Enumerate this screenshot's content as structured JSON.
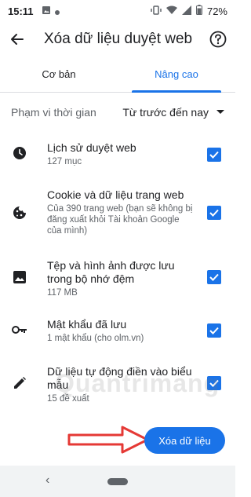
{
  "status": {
    "time": "15:11",
    "battery": "72%"
  },
  "appbar": {
    "title": "Xóa dữ liệu duyệt web"
  },
  "tabs": [
    {
      "label": "Cơ bản"
    },
    {
      "label": "Nâng cao"
    }
  ],
  "range": {
    "label": "Phạm vi thời gian",
    "value": "Từ trước đến nay"
  },
  "items": [
    {
      "title": "Lịch sử duyệt web",
      "subtitle": "127 mục",
      "icon": "clock-icon"
    },
    {
      "title": "Cookie và dữ liệu trang web",
      "subtitle": "Của 390 trang web (bạn sẽ không bị đăng xuất khỏi Tài khoản Google của mình)",
      "icon": "cookie-icon"
    },
    {
      "title": "Tệp và hình ảnh được lưu trong bộ nhớ đệm",
      "subtitle": "117 MB",
      "icon": "image-icon"
    },
    {
      "title": "Mật khẩu đã lưu",
      "subtitle": "1 mật khẩu (cho olm.vn)",
      "icon": "key-icon"
    },
    {
      "title": "Dữ liệu tự động điền vào biểu mẫu",
      "subtitle": "15 đề xuất",
      "icon": "pencil-icon"
    }
  ],
  "watermark": "Quantrimang",
  "action": {
    "label": "Xóa dữ liệu"
  },
  "colors": {
    "accent": "#1a73e8",
    "annotation": "#e53935"
  }
}
